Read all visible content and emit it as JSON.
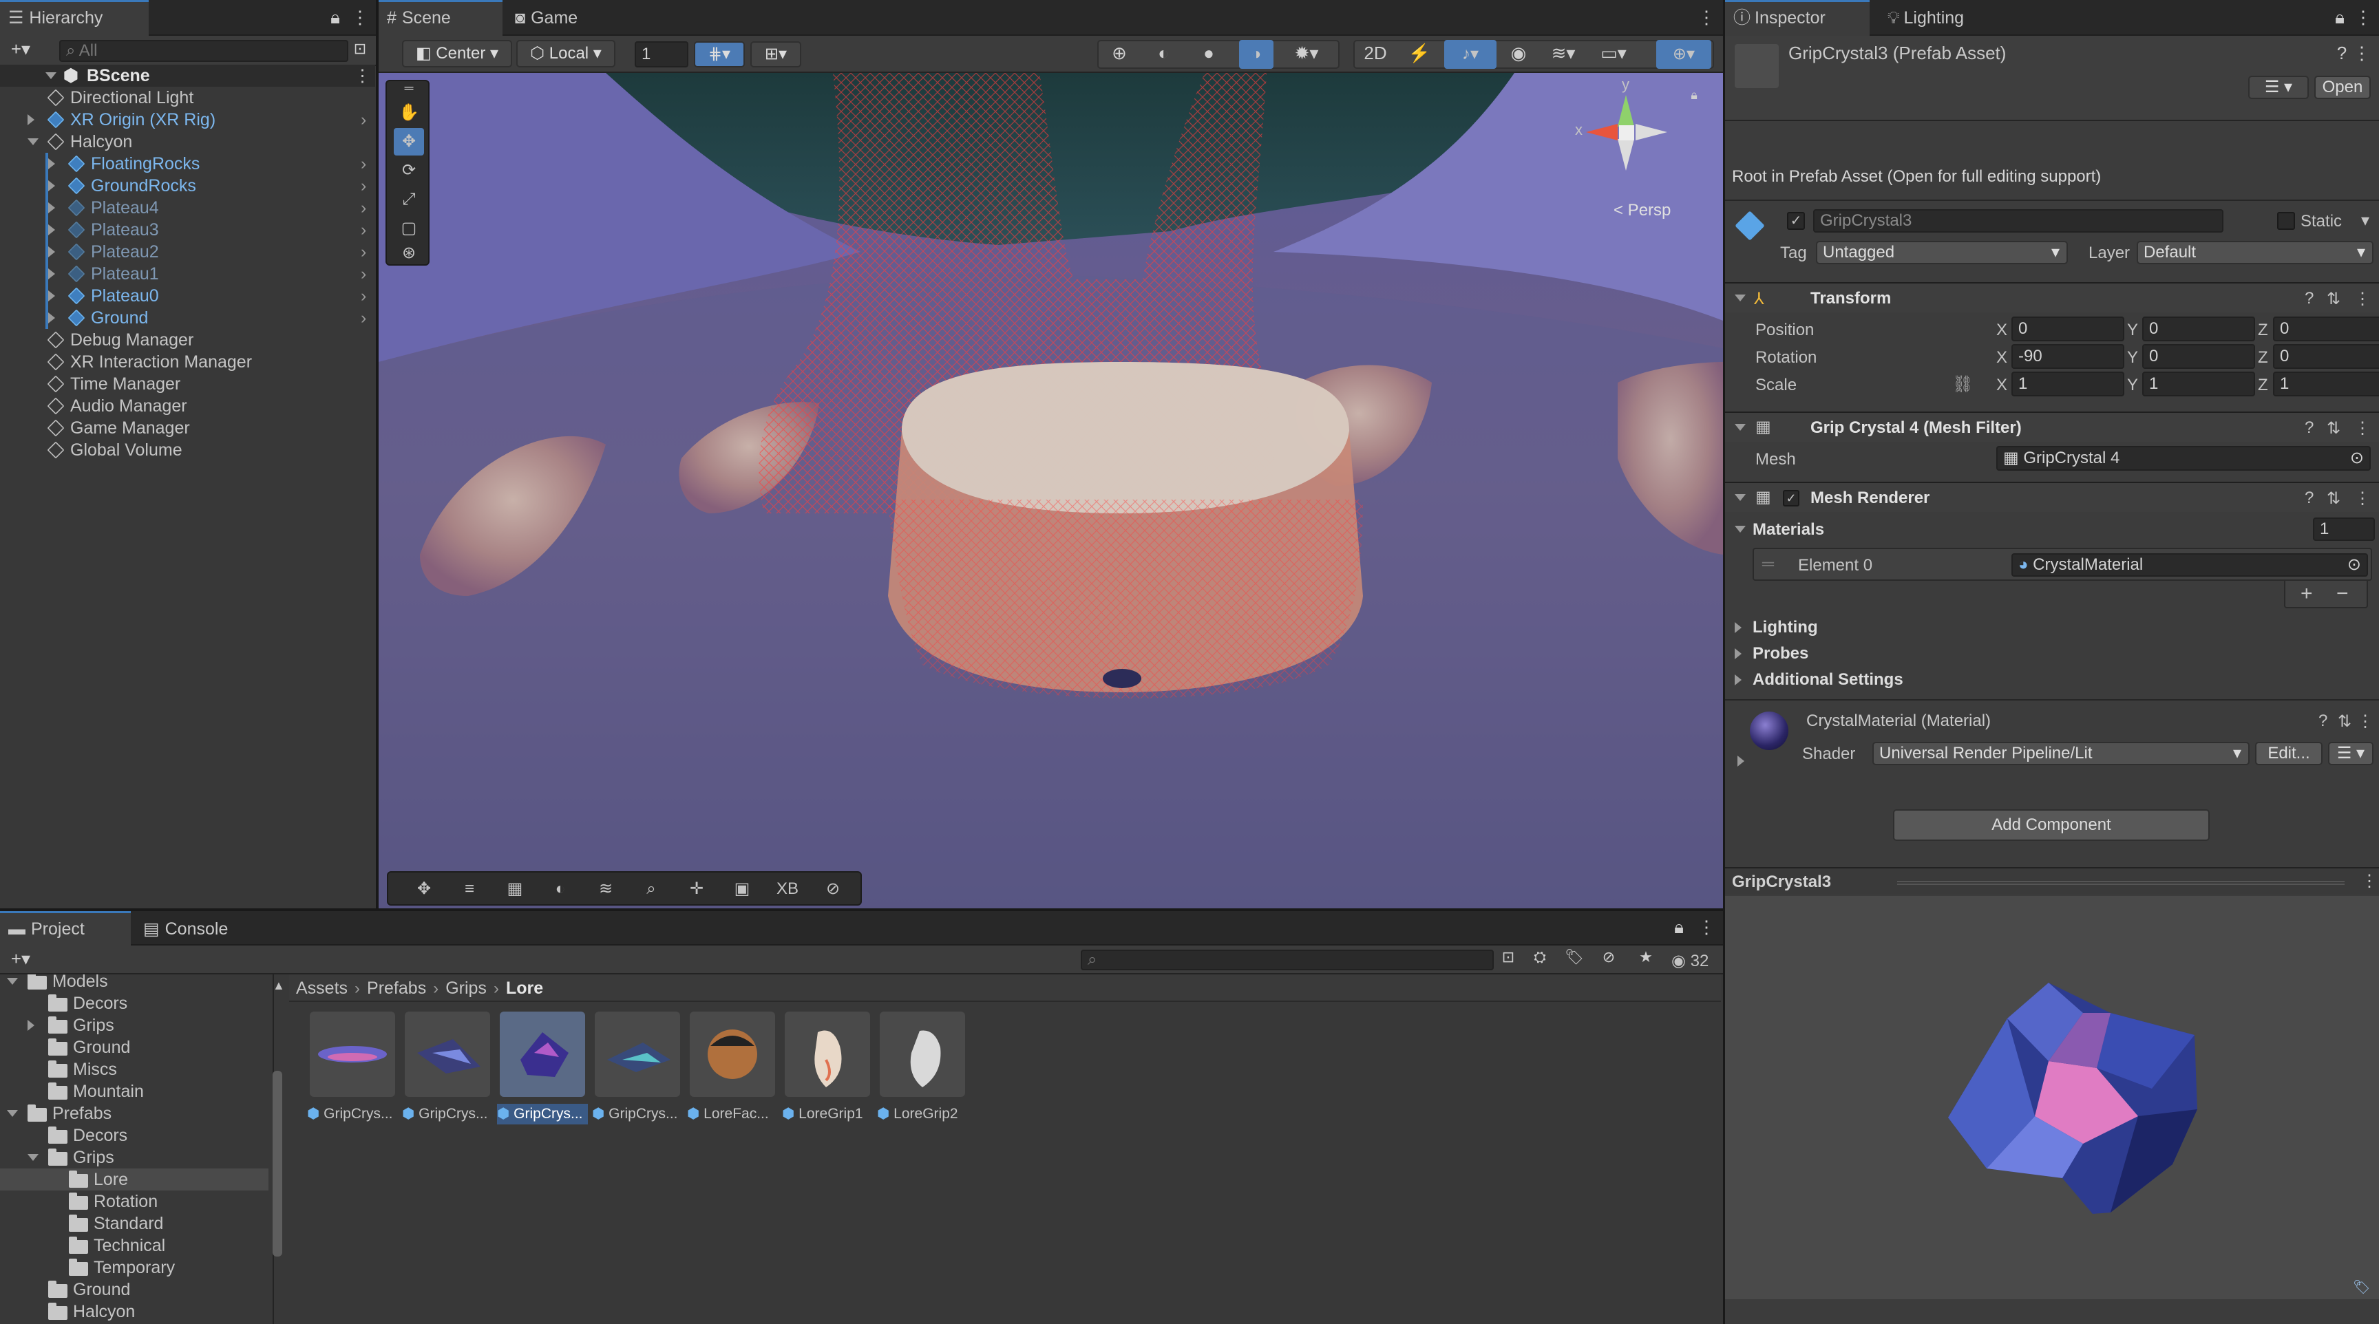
{
  "hierarchy": {
    "tab": "Hierarchy",
    "search_placeholder": "All",
    "scene": "BScene",
    "items": [
      {
        "label": "Directional Light",
        "style": "normal"
      },
      {
        "label": "XR Origin (XR Rig)",
        "style": "blue"
      },
      {
        "label": "Halcyon",
        "style": "normal"
      },
      {
        "label": "FloatingRocks",
        "style": "blue"
      },
      {
        "label": "GroundRocks",
        "style": "blue"
      },
      {
        "label": "Plateau4",
        "style": "gray"
      },
      {
        "label": "Plateau3",
        "style": "gray"
      },
      {
        "label": "Plateau2",
        "style": "gray"
      },
      {
        "label": "Plateau1",
        "style": "gray"
      },
      {
        "label": "Plateau0",
        "style": "blue"
      },
      {
        "label": "Ground",
        "style": "blue"
      },
      {
        "label": "Debug Manager",
        "style": "normal"
      },
      {
        "label": "XR Interaction Manager",
        "style": "normal"
      },
      {
        "label": "Time Manager",
        "style": "normal"
      },
      {
        "label": "Audio Manager",
        "style": "normal"
      },
      {
        "label": "Game Manager",
        "style": "normal"
      },
      {
        "label": "Global Volume",
        "style": "normal"
      }
    ]
  },
  "scene_view": {
    "tabs": [
      "Scene",
      "Game"
    ],
    "pivot": "Center",
    "space": "Local",
    "grid_snap": "1",
    "persp_label": "< Persp",
    "gizmo_y": "y",
    "gizmo_x": "x",
    "overlay_xb": "XB"
  },
  "inspector": {
    "tabs": [
      "Inspector",
      "Lighting"
    ],
    "asset_title": "GripCrystal3 (Prefab Asset)",
    "open_button": "Open",
    "root_note": "Root in Prefab Asset (Open for full editing support)",
    "object_name": "GripCrystal3",
    "static_label": "Static",
    "tag_label": "Tag",
    "tag_value": "Untagged",
    "layer_label": "Layer",
    "layer_value": "Default",
    "transform": {
      "title": "Transform",
      "rows": [
        {
          "label": "Position",
          "x": "0",
          "y": "0",
          "z": "0"
        },
        {
          "label": "Rotation",
          "x": "-90",
          "y": "0",
          "z": "0"
        },
        {
          "label": "Scale",
          "x": "1",
          "y": "1",
          "z": "1"
        }
      ],
      "axis_x": "X",
      "axis_y": "Y",
      "axis_z": "Z"
    },
    "mesh_filter": {
      "title": "Grip Crystal 4 (Mesh Filter)",
      "mesh_label": "Mesh",
      "mesh_value": "GripCrystal 4"
    },
    "mesh_renderer": {
      "title": "Mesh Renderer",
      "materials_label": "Materials",
      "materials_count": "1",
      "element_label": "Element 0",
      "element_value": "CrystalMaterial",
      "plus": "+",
      "minus": "−",
      "foldouts": [
        "Lighting",
        "Probes",
        "Additional Settings"
      ]
    },
    "material": {
      "title": "CrystalMaterial (Material)",
      "shader_label": "Shader",
      "shader_value": "Universal Render Pipeline/Lit",
      "edit_button": "Edit..."
    },
    "add_component": "Add Component",
    "preview_title": "GripCrystal3"
  },
  "project": {
    "tabs": [
      "Project",
      "Console"
    ],
    "count": "32",
    "breadcrumb": [
      "Assets",
      "Prefabs",
      "Grips",
      "Lore"
    ],
    "tree": [
      {
        "label": "Models",
        "indent": 1,
        "arrow": "down"
      },
      {
        "label": "Decors",
        "indent": 2,
        "arrow": "none"
      },
      {
        "label": "Grips",
        "indent": 2,
        "arrow": "right"
      },
      {
        "label": "Ground",
        "indent": 2,
        "arrow": "none"
      },
      {
        "label": "Miscs",
        "indent": 2,
        "arrow": "none"
      },
      {
        "label": "Mountain",
        "indent": 2,
        "arrow": "none"
      },
      {
        "label": "Prefabs",
        "indent": 1,
        "arrow": "down"
      },
      {
        "label": "Decors",
        "indent": 2,
        "arrow": "none"
      },
      {
        "label": "Grips",
        "indent": 2,
        "arrow": "down"
      },
      {
        "label": "Lore",
        "indent": 3,
        "arrow": "none"
      },
      {
        "label": "Rotation",
        "indent": 3,
        "arrow": "none"
      },
      {
        "label": "Standard",
        "indent": 3,
        "arrow": "none"
      },
      {
        "label": "Technical",
        "indent": 3,
        "arrow": "none"
      },
      {
        "label": "Temporary",
        "indent": 3,
        "arrow": "none"
      },
      {
        "label": "Ground",
        "indent": 2,
        "arrow": "none"
      },
      {
        "label": "Halcyon",
        "indent": 2,
        "arrow": "none"
      }
    ],
    "assets": [
      "GripCrys...",
      "GripCrys...",
      "GripCrys...",
      "GripCrys...",
      "LoreFac...",
      "LoreGrip1",
      "LoreGrip2"
    ]
  },
  "colors": {
    "accent": "#3a79bb",
    "prefab_blue": "#7cb7ee",
    "wireframe": "#ff3b3b"
  }
}
